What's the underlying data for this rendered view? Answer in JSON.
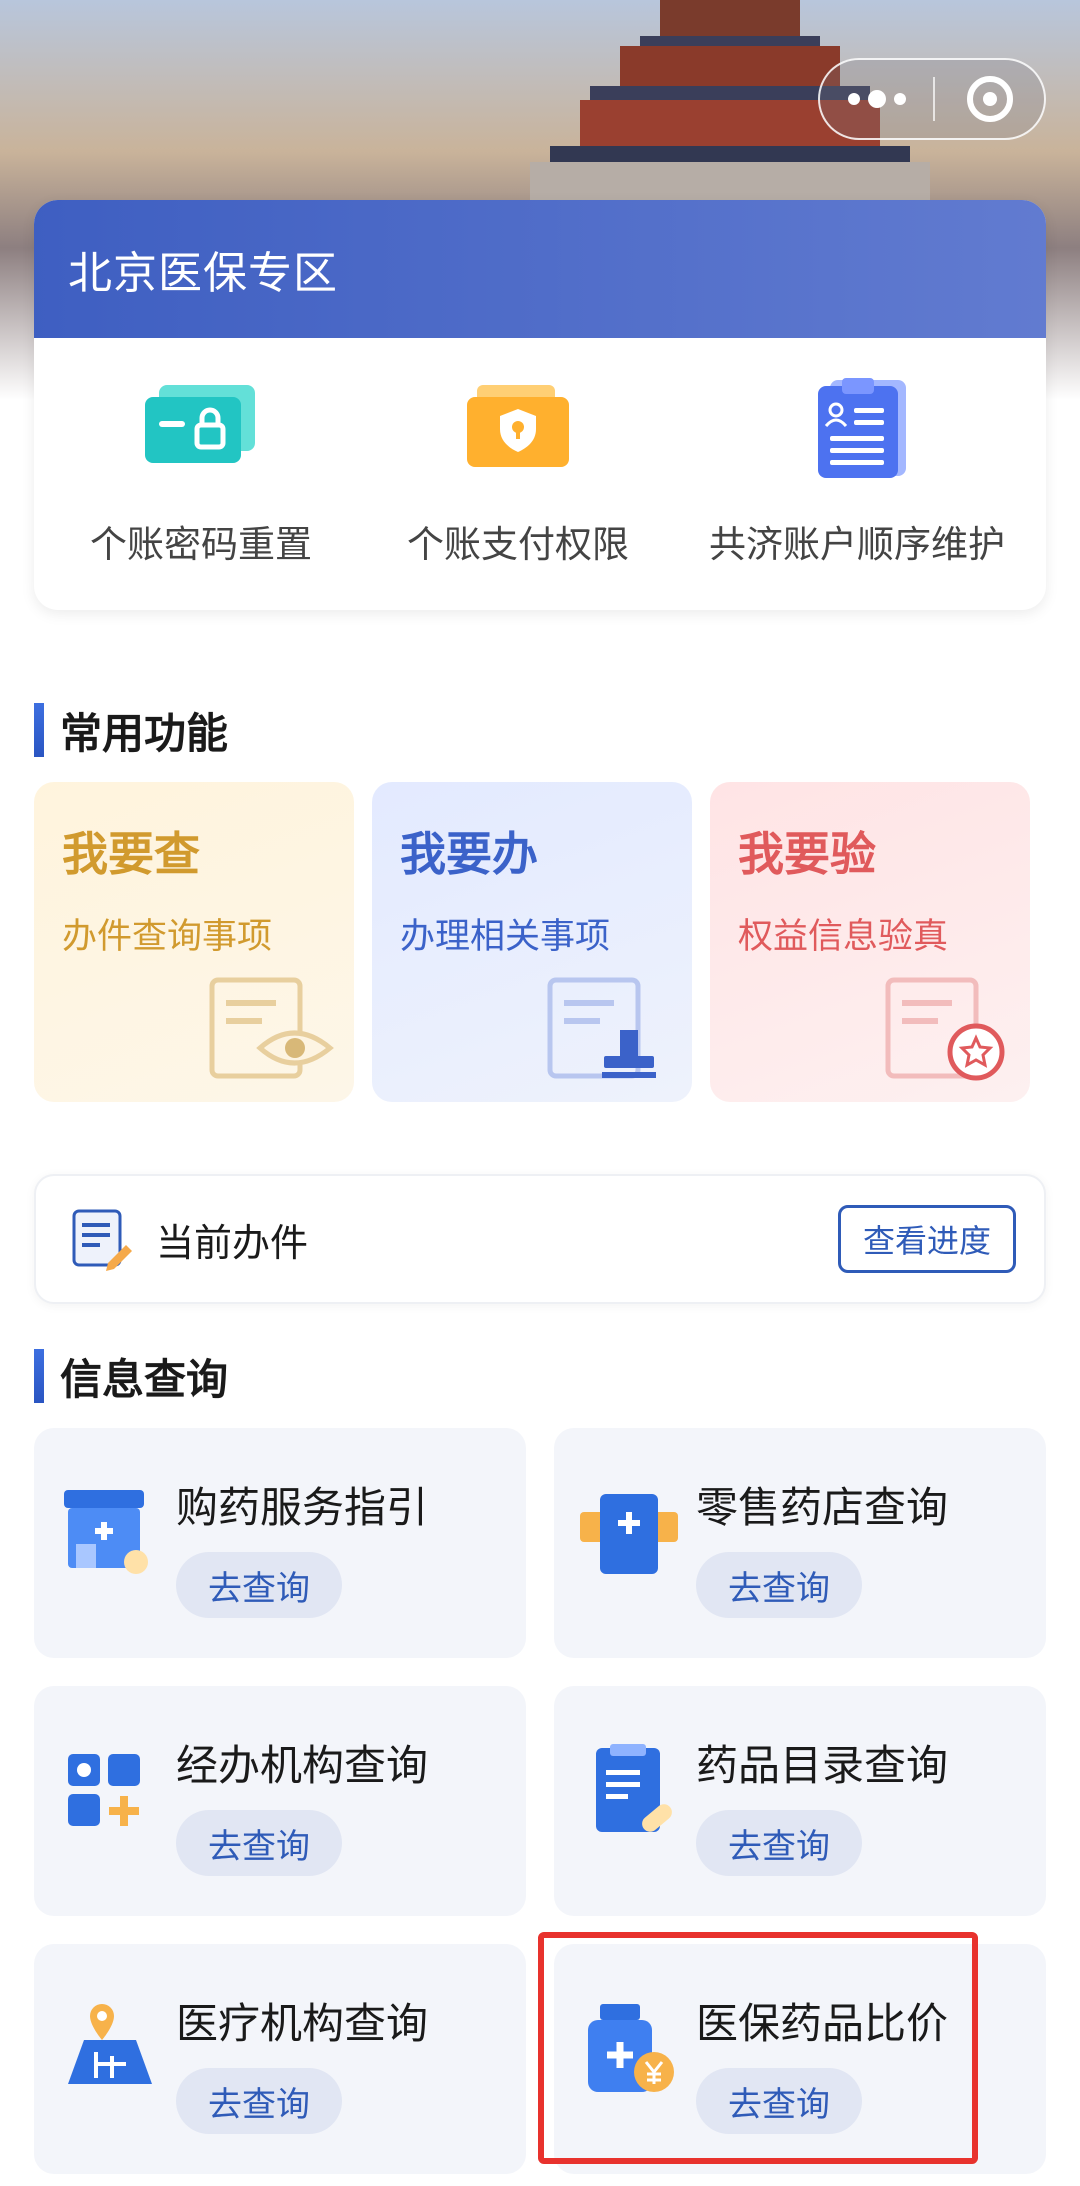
{
  "zone": {
    "title": "北京医保专区",
    "items": [
      {
        "label": "个账密码重置",
        "icon": "card-lock-icon"
      },
      {
        "label": "个账支付权限",
        "icon": "wallet-shield-icon"
      },
      {
        "label": "共济账户顺序维护",
        "icon": "clipboard-user-icon"
      }
    ]
  },
  "common": {
    "title": "常用功能",
    "cards": [
      {
        "title": "我要查",
        "sub": "办件查询事项",
        "icon": "document-eye-icon"
      },
      {
        "title": "我要办",
        "sub": "办理相关事项",
        "icon": "document-stamp-icon"
      },
      {
        "title": "我要验",
        "sub": "权益信息验真",
        "icon": "document-star-icon"
      }
    ]
  },
  "current_task": {
    "label": "当前办件",
    "button": "查看进度"
  },
  "info": {
    "title": "信息查询",
    "button_label": "去查询",
    "items": [
      {
        "label": "购药服务指引",
        "icon": "pharmacy-store-icon"
      },
      {
        "label": "零售药店查询",
        "icon": "medicine-box-icon"
      },
      {
        "label": "经办机构查询",
        "icon": "grid-plus-icon"
      },
      {
        "label": "药品目录查询",
        "icon": "document-pill-icon"
      },
      {
        "label": "医疗机构查询",
        "icon": "map-pin-icon"
      },
      {
        "label": "医保药品比价",
        "icon": "medicine-price-icon"
      }
    ]
  },
  "colors": {
    "brand_blue": "#2f5bb8",
    "highlight_red": "#e8322d",
    "query_gold": "#d19a2e",
    "verify_red": "#e05a5c"
  }
}
